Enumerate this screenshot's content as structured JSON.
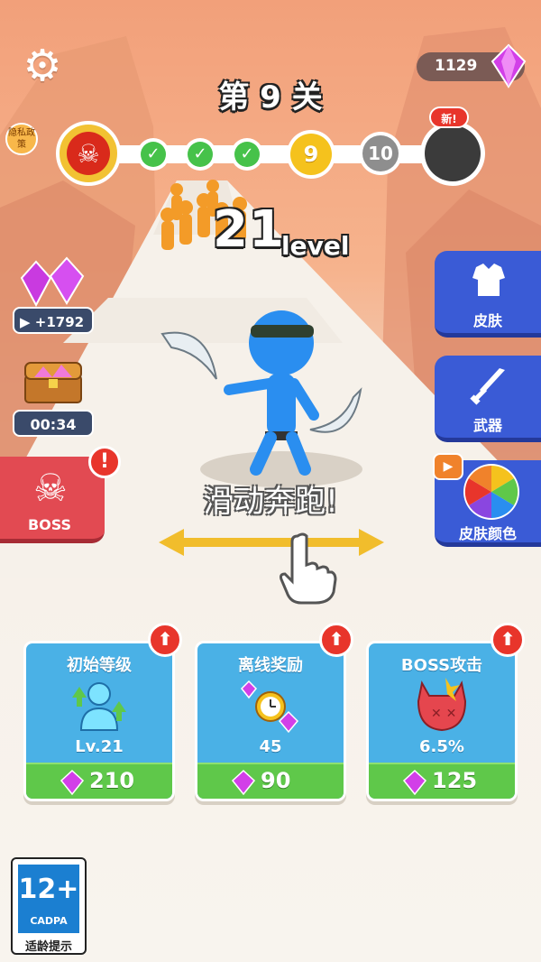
{
  "header": {
    "settings_icon": "gear-icon",
    "gem_count": "1129",
    "stage_title": "第 9 关",
    "privacy_label": "隐私政策"
  },
  "progress": {
    "completed_icon": "check-icon",
    "current_stage": "9",
    "next_stage": "10",
    "new_badge": "新!"
  },
  "player": {
    "level_number": "21",
    "level_word": "level"
  },
  "left_panel": {
    "gem_reward": "+1792",
    "chest_timer": "00:34",
    "boss_label": "BOSS",
    "alert_mark": "!"
  },
  "right_panel": {
    "skin_label": "皮肤",
    "weapon_label": "武器",
    "skin_color_label": "皮肤颜色"
  },
  "hint": {
    "swipe_text": "滑动奔跑!"
  },
  "upgrades": [
    {
      "title": "初始等级",
      "value": "Lv.21",
      "cost": "210"
    },
    {
      "title": "离线奖励",
      "value": "45",
      "cost": "90"
    },
    {
      "title": "BOSS攻击",
      "value": "6.5%",
      "cost": "125"
    }
  ],
  "rating": {
    "age": "12+",
    "org": "CADPA",
    "tip": "适龄提示"
  },
  "colors": {
    "gem": "#c93ae0",
    "boss_red": "#e24a52",
    "side_blue": "#3a5bd6",
    "card_blue": "#4ab1e6",
    "cost_green": "#5fc84a",
    "progress_yellow": "#f5c21d"
  }
}
